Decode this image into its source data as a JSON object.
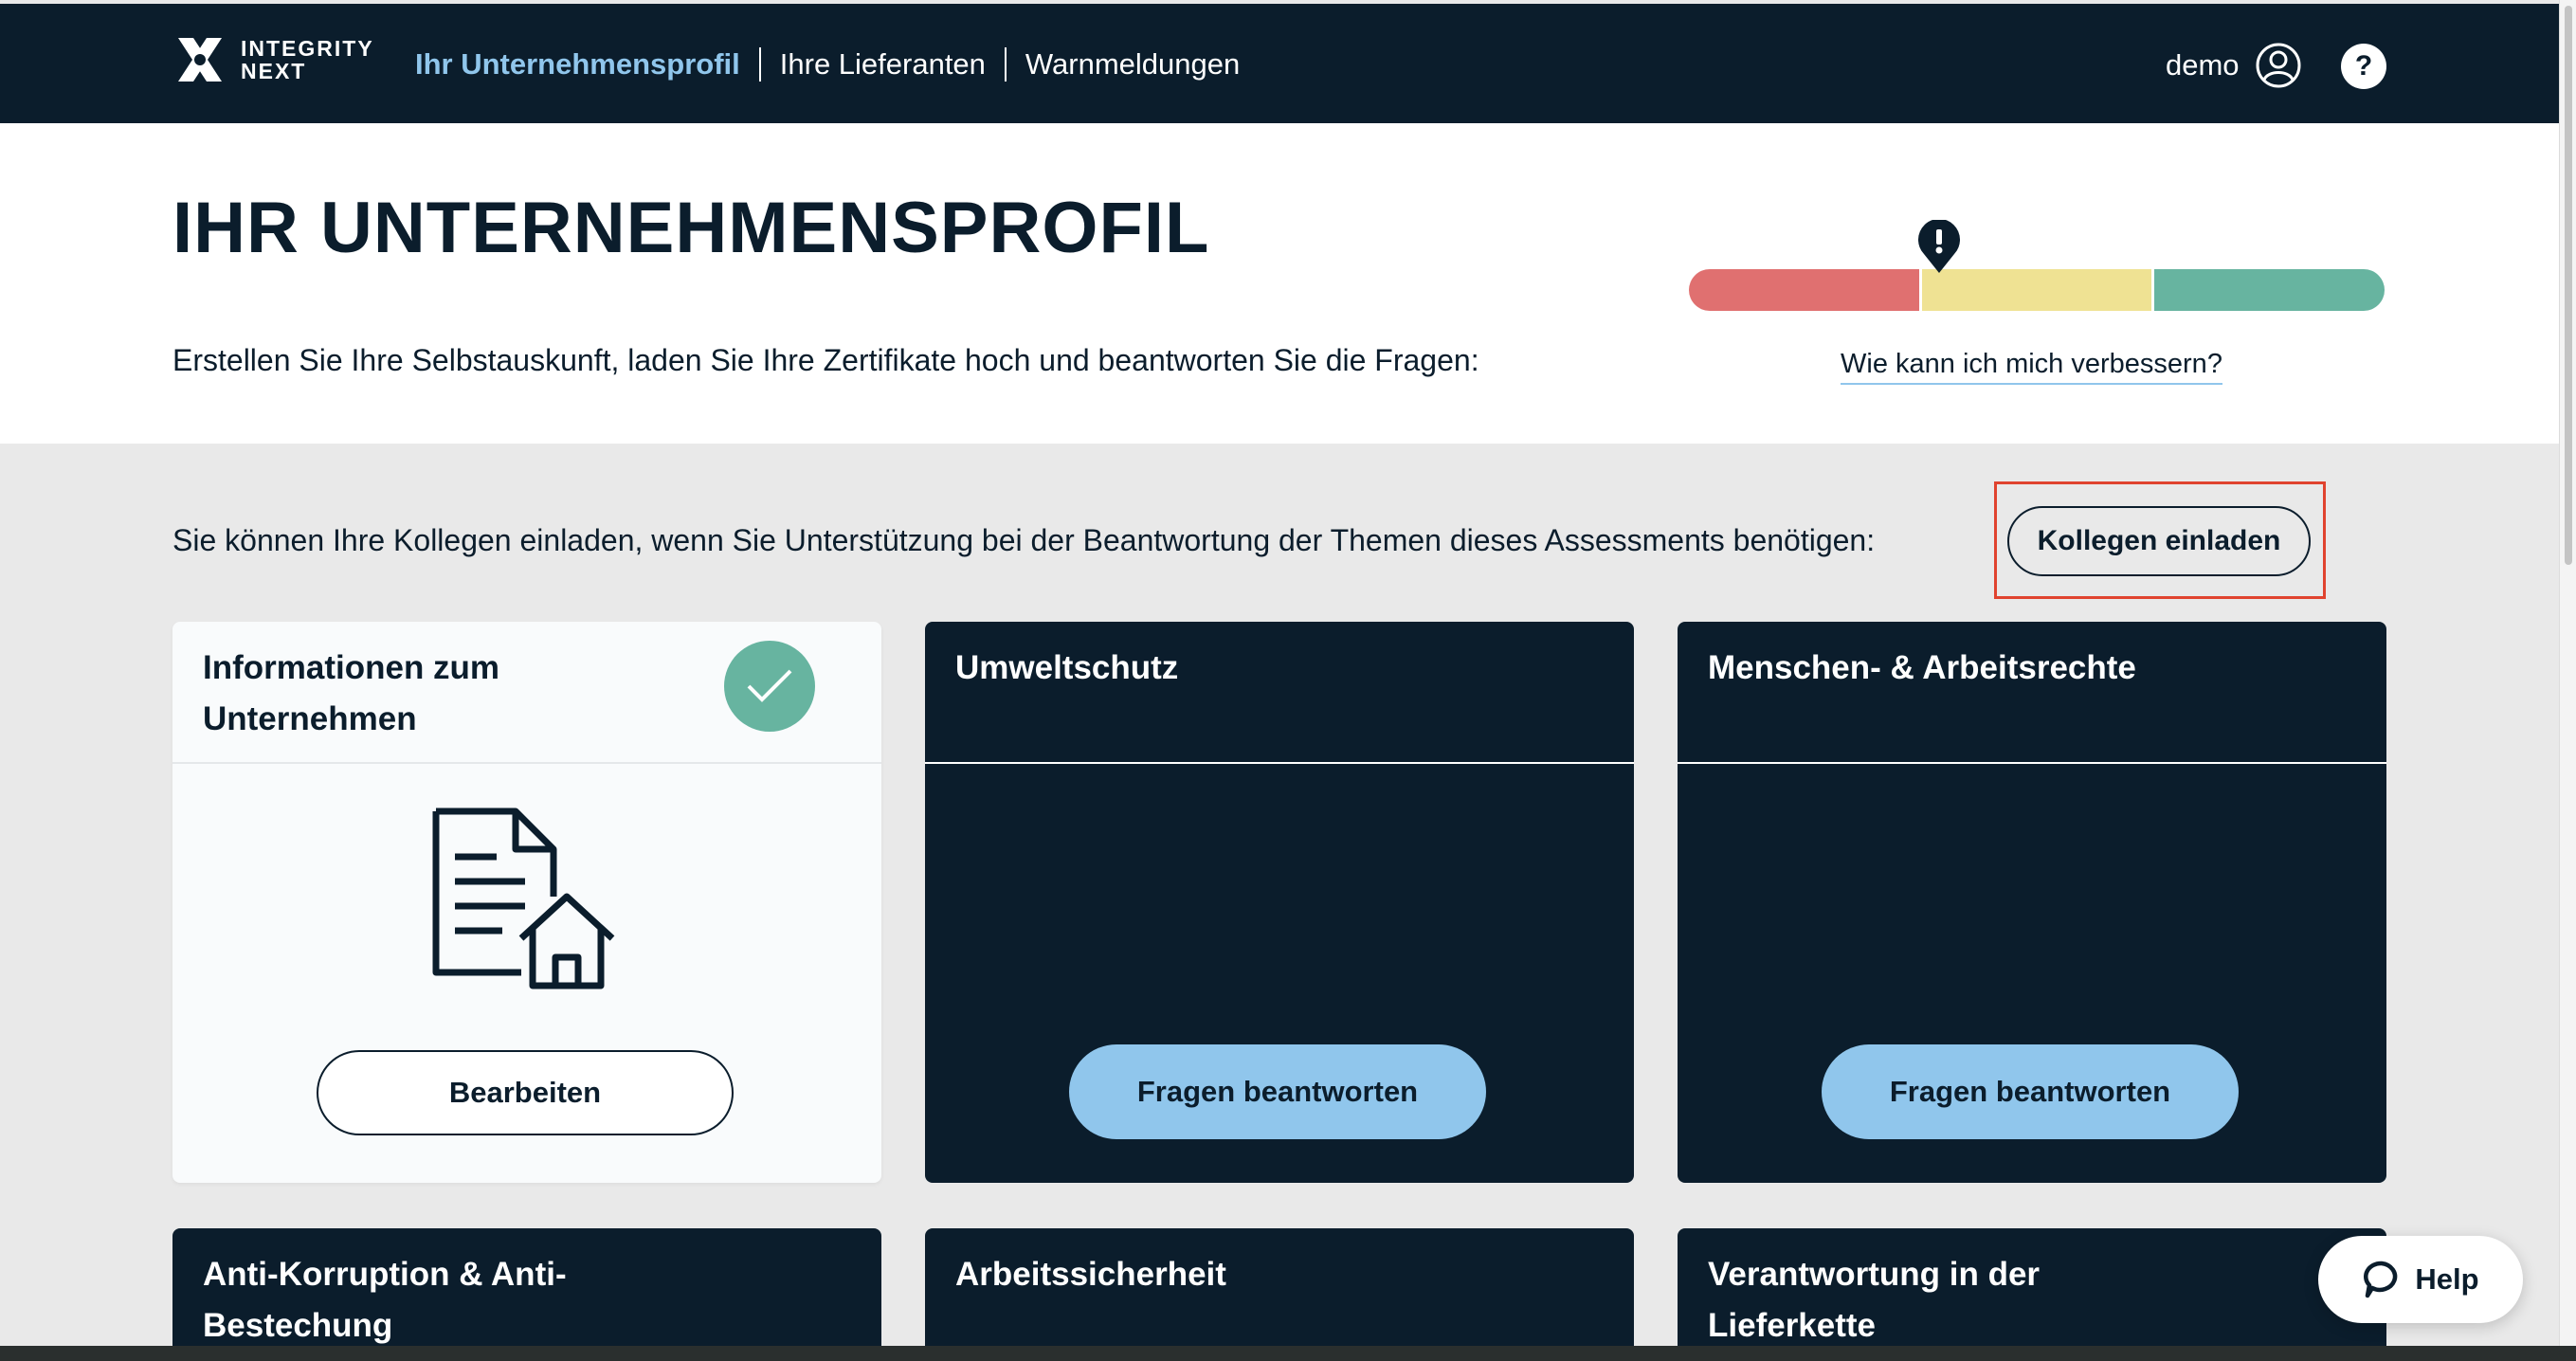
{
  "brand": {
    "line1": "INTEGRITY",
    "line2": "NEXT"
  },
  "nav": {
    "items": [
      {
        "label": "Ihr Unternehmensprofil",
        "active": true
      },
      {
        "label": "Ihre Lieferanten",
        "active": false
      },
      {
        "label": "Warnmeldungen",
        "active": false
      }
    ],
    "user": "demo",
    "help_icon": "?"
  },
  "header": {
    "title": "IHR UNTERNEHMENSPROFIL",
    "subtitle": "Erstellen Sie Ihre Selbstauskunft, laden Sie Ihre Zertifikate hoch und beantworten Sie die Fragen:",
    "improve_link": "Wie kann ich mich verbessern?",
    "score_colors": [
      "#e07070",
      "#efe293",
      "#67b4a0"
    ],
    "marker_icon": "alert-marker-icon"
  },
  "invite": {
    "text": "Sie können Ihre Kollegen einladen, wenn Sie Unterstützung bei der Beantwortung der Themen dieses Assessments benötigen:",
    "button": "Kollegen einladen"
  },
  "cards": [
    {
      "title": "Informationen zum Unternehmen",
      "button": "Bearbeiten",
      "completed": true
    },
    {
      "title": "Umweltschutz",
      "button": "Fragen beantworten"
    },
    {
      "title": "Menschen- & Arbeitsrechte",
      "button": "Fragen beantworten"
    },
    {
      "title": "Anti-Korruption & Anti-Bestechung"
    },
    {
      "title": "Arbeitssicherheit"
    },
    {
      "title": "Verantwortung in der Lieferkette"
    }
  ],
  "help_fab": {
    "label": "Help"
  },
  "colors": {
    "navy": "#0b1d2c",
    "accent_blue": "#90c6ec",
    "highlight": "#e0432f"
  }
}
